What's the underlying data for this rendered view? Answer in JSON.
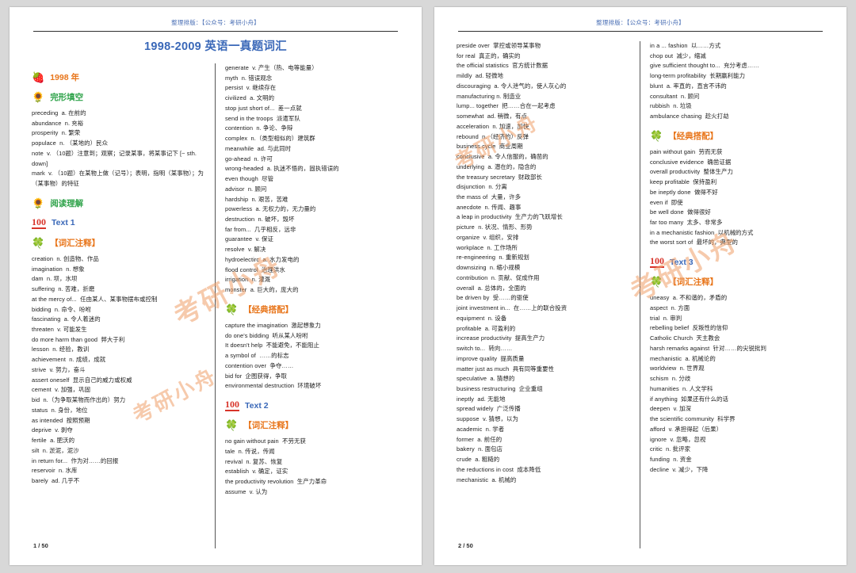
{
  "viewer": {
    "background": "#d8d8d8",
    "accent_blue": "#3a68b8",
    "accent_orange": "#e8751a",
    "accent_green": "#2fa34a",
    "accent_red": "#d8342a"
  },
  "pages": [
    {
      "header": "整理排版：【公众号：考研小舟】",
      "footer": "1 / 50",
      "title": "1998-2009 英语一真题词汇",
      "watermarks": [
        "考研小舟",
        "考研小舟"
      ],
      "left_column": {
        "blocks": [
          {
            "type": "section",
            "icon": "strawberry-icon",
            "glyph": "🍓",
            "label": "1998 年",
            "color": "orange"
          },
          {
            "type": "section",
            "icon": "sunflower-icon",
            "glyph": "🌻",
            "label": "完形填空",
            "color": "green"
          },
          {
            "type": "entries",
            "items": [
              "preceding  a. 在前的",
              "abundance  n. 充裕",
              "prosperity  n. 繁荣",
              "populace  n. （某地的）民众",
              "note  v. （10题）注意到；观察；记录某事，将某事记下 [~ sth. down]",
              "mark  v. （10题）在某物上做（记号）；表明，指明（某事物）；为（某事物）的特征"
            ]
          },
          {
            "type": "section",
            "icon": "sunflower-icon",
            "glyph": "🌻",
            "label": "阅读理解",
            "color": "green"
          },
          {
            "type": "section",
            "icon": "hundred-icon",
            "glyph": "100",
            "label": "Text 1",
            "color": "blue"
          },
          {
            "type": "section",
            "icon": "clover-icon",
            "glyph": "🍀",
            "label": "【词汇注释】",
            "color": "orange"
          },
          {
            "type": "entries",
            "items": [
              "creation  n. 创造物、作品",
              "imagination  n. 想象",
              "dam  n. 坝，水坝",
              "suffering  n. 苦难，折磨",
              "at the mercy of...  任由某人、某事物摆布或控制",
              "bidding  n. 命令、吩咐",
              "fascinating  a. 令人着迷的",
              "threaten  v. 可能发生",
              "do more harm than good  弊大于利",
              "lesson  n. 经验，教训",
              "achievement  n. 成绩，成就",
              "strive  v. 努力，奋斗",
              "assert oneself  显示自己的威力或权威",
              "cement  v. 加强，巩固",
              "bid  n.（为争取某物而作出的）努力",
              "status  n. 身份，地位",
              "as intended  按照预期",
              "deprive  v. 剥夺",
              "fertile  a. 肥沃的",
              "silt  n. 淤泥，泥沙",
              "in return for...  作为对……的回报",
              "reservoir  n. 水库",
              "barely  ad. 几乎不"
            ]
          }
        ]
      },
      "right_column": {
        "blocks": [
          {
            "type": "entries",
            "items": [
              "generate  v. 产生（热、电等能量）",
              "myth  n. 错误观念",
              "persist  v. 继续存在",
              "civilized  a. 文明的",
              "stop just short of...  差一点就",
              "send in the troops  派遣军队",
              "contention  n. 争论、争辩",
              "complex  n.（类型相似的）建筑群",
              "meanwhile  ad. 与此同时",
              "go-ahead  n. 许可",
              "wrong-headed  a. 执迷不悟的，固执错误的",
              "even though  尽管",
              "advisor  n. 顾问",
              "hardship  n. 艰苦，苦难",
              "powerless  a. 无权力的，无力量的",
              "destruction  n. 破坏，毁坏",
              "far from...  几乎相反，远非",
              "guarantee  v. 保证",
              "resolve  v. 解决",
              "hydroelectirc  a. 水力发电的",
              "flood control  治理洪水",
              "irrigation  n. 灌溉",
              "monster  a. 巨大的，庞大的"
            ]
          },
          {
            "type": "section",
            "icon": "clover-icon",
            "glyph": "🍀",
            "label": "【经典搭配】",
            "color": "orange"
          },
          {
            "type": "entries",
            "items": [
              "capture the imagination  激起想象力",
              "do one's bidding  听从某人吩咐",
              "It doesn't help  不能避免，不能阻止",
              "a symbol of  ……的标志",
              "contention over  争夺……",
              "bid for  企图获得，争取",
              "environmental destruction  环境破坏"
            ]
          },
          {
            "type": "section",
            "icon": "hundred-icon",
            "glyph": "100",
            "label": "Text 2",
            "color": "blue"
          },
          {
            "type": "section",
            "icon": "clover-icon",
            "glyph": "🍀",
            "label": "【词汇注释】",
            "color": "orange"
          },
          {
            "type": "entries",
            "items": [
              "no gain without pain  不劳无获",
              "tale  n. 传说，传闻",
              "revival  n. 复苏、恢复",
              "establish  v. 确定，证实",
              "the productivity revolution  生产力革命",
              "assume  v. 认为"
            ]
          }
        ]
      }
    },
    {
      "header": "整理排版：【公众号：考研小舟】",
      "footer": "2 / 50",
      "title": "",
      "watermarks": [
        "考研小舟",
        "考研小舟"
      ],
      "left_column": {
        "blocks": [
          {
            "type": "entries",
            "items": [
              "preside over  掌控或领导某事物",
              "for real  真正的，确实的",
              "the official statistics  官方统计数据",
              "mildly  ad. 轻微地",
              "discouraging  a. 令人泄气的，使人灰心的",
              "manufacturing n. 制造业",
              "lump... together  把……合在一起考虑",
              "somewhat  ad. 稍微，有点",
              "acceleration  n. 加速，加快",
              "rebound  n.（经济的）反弹",
              "business cycle  商业周期",
              "conclusive  a. 令人信服的，确凿的",
              "underlying  a. 潜在的，隐含的",
              "the treasury secretary  财政部长",
              "disjunction  n. 分离",
              "the mass of  大量，许多",
              "anecdote  n. 传闻、趣事",
              "a leap in productivity  生产力的飞跃增长",
              "picture  n. 状况、情形、形势",
              "organize  v. 组织，安排",
              "workplace  n. 工作场所",
              "re-engineering  n. 重新规划",
              "downsizing  n. 缩小规模",
              "contribution  n. 贡献、促成作用",
              "overall  a. 总体的，全面的",
              "be driven by  受……的驱使",
              "joint investment in...  在……上的联合投资",
              "equipment  n. 设备",
              "profitable  a. 可盈利的",
              "increase productivity  提高生产力",
              "switch to...  转向……",
              "improve quality  提高质量",
              "matter just as much  具有同等重要性",
              "speculative  a. 猜想的",
              "business restructuring  企业重组",
              "ineptly  ad. 无能地",
              "spread widely  广泛传播",
              "suppose  v. 猜想，以为",
              "academic  n. 学者",
              "former  a. 前任的",
              "bakery  n. 面包店",
              "crude  a. 粗糙的",
              "the reductions in cost  成本降低",
              "mechanistic  a. 机械的"
            ]
          }
        ]
      },
      "right_column": {
        "blocks": [
          {
            "type": "entries",
            "items": [
              "in a ... fashion  以……方式",
              "chop out  减少，缩减",
              "give sufficient thought to...  充分考虑……",
              "long-term profitability  长期赢利能力",
              "blunt  a. 率直的，直言不讳的",
              "consultant  n. 顾问",
              "rubbish  n. 垃圾",
              "ambulance chasing  趁火打劫"
            ]
          },
          {
            "type": "section",
            "icon": "clover-icon",
            "glyph": "🍀",
            "label": "【经典搭配】",
            "color": "orange"
          },
          {
            "type": "entries",
            "items": [
              "pain without gain  劳而无获",
              "conclusive evidence  确凿证据",
              "overall productivity  整体生产力",
              "keep profitable  保持盈利",
              "be ineptly done  做得不好",
              "even if  即使",
              "be well done  做得很好",
              "far too many  太多、非常多",
              "in a mechanistic fashion  以机械的方式",
              "the worst sort of  最坏的，典型的"
            ]
          },
          {
            "type": "section",
            "icon": "hundred-icon",
            "glyph": "100",
            "label": "Text 3",
            "color": "blue"
          },
          {
            "type": "section",
            "icon": "clover-icon",
            "glyph": "🍀",
            "label": "【词汇注释】",
            "color": "orange"
          },
          {
            "type": "entries",
            "items": [
              "uneasy  a. 不和谐的，矛盾的",
              "aspect  n. 方面",
              "trial  n. 审判",
              "rebelling belief  反叛性的信仰",
              "Catholic Church  天主教会",
              "harsh remarks against  针对……的尖锐批判",
              "mechanistic  a. 机械论的",
              "worldview  n. 世界观",
              "schism  n. 分歧",
              "humanities  n. 人文学科",
              "if anything  如果还有什么的话",
              "deepen  v. 加深",
              "the scientific community  科学界",
              "afford  v. 承担得起（后果）",
              "ignore  v. 忽略，忽视",
              "critic  n. 批评家",
              "funding  n. 资金",
              "decline  v. 减少，下降"
            ]
          }
        ]
      }
    }
  ]
}
